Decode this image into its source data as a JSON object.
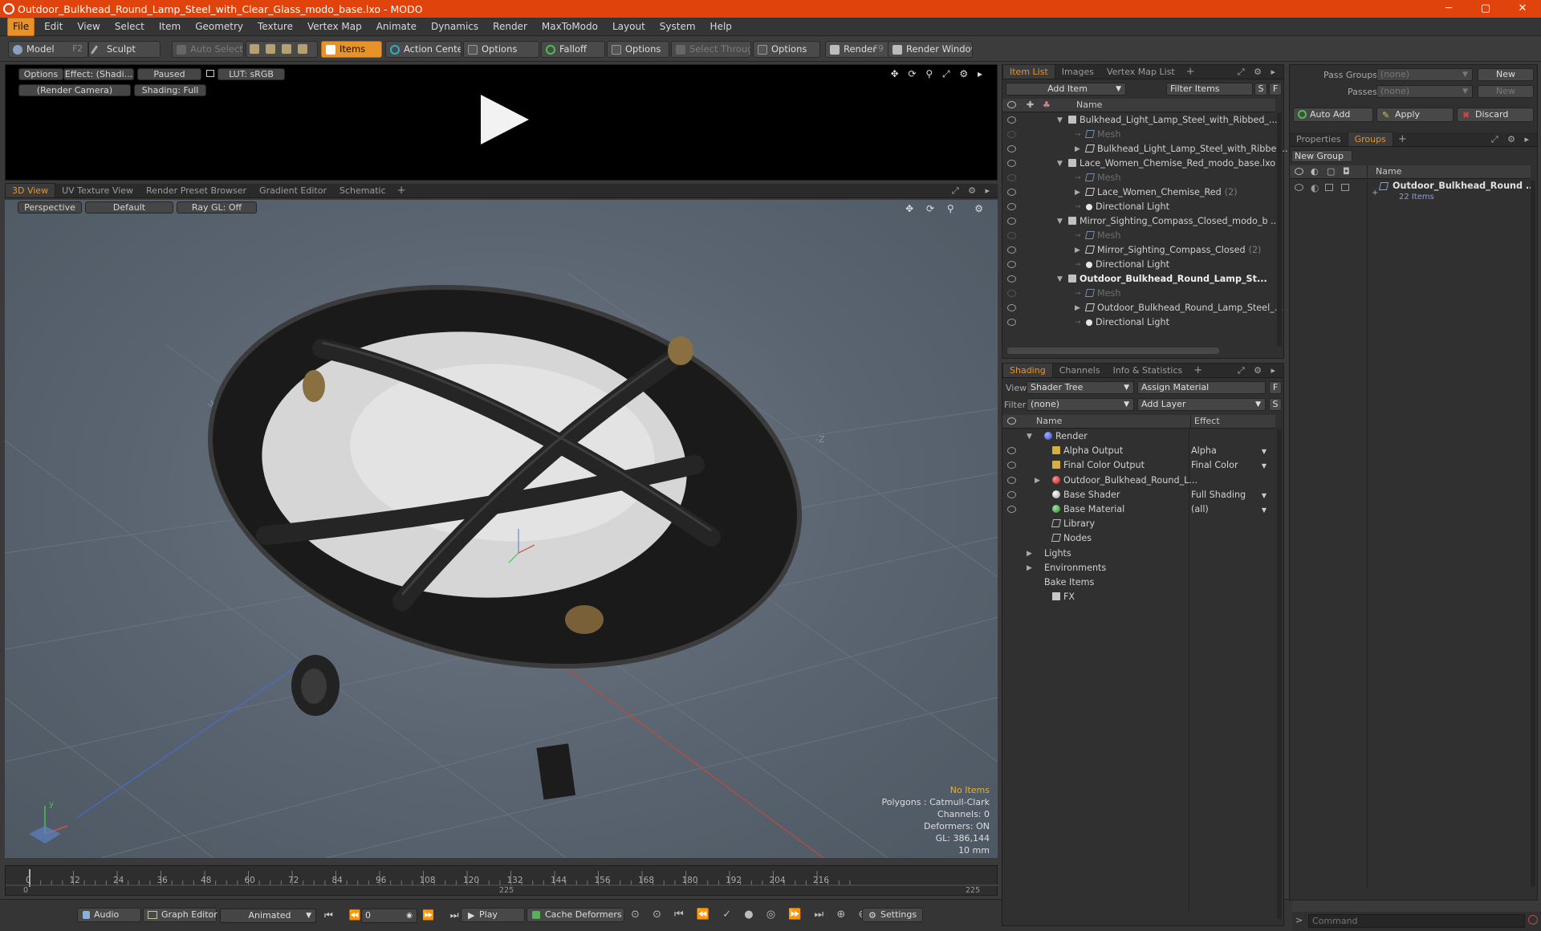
{
  "window": {
    "title": "Outdoor_Bulkhead_Round_Lamp_Steel_with_Clear_Glass_modo_base.lxo - MODO",
    "minimize": "─",
    "maximize": "▢",
    "close": "✕"
  },
  "menu": [
    "File",
    "Edit",
    "View",
    "Select",
    "Item",
    "Geometry",
    "Texture",
    "Vertex Map",
    "Animate",
    "Dynamics",
    "Render",
    "MaxToModo",
    "Layout",
    "System",
    "Help"
  ],
  "toolbar": {
    "model": "Model",
    "model_key": "F2",
    "sculpt": "Sculpt",
    "auto_select": "Auto Select",
    "items": "Items",
    "action_center": "Action Center",
    "options1": "Options",
    "falloff": "Falloff",
    "options2": "Options",
    "select_through": "Select Through",
    "options3": "Options",
    "render": "Render",
    "render_key": "F9",
    "render_window": "Render Window"
  },
  "render_preview": {
    "options": "Options",
    "effect": "Effect: (Shadi...",
    "paused": "Paused",
    "lut": "LUT: sRGB",
    "camera": "(Render Camera)",
    "shading": "Shading: Full"
  },
  "viewport_tabs": [
    "3D View",
    "UV Texture View",
    "Render Preset Browser",
    "Gradient Editor",
    "Schematic"
  ],
  "viewport": {
    "perspective": "Perspective",
    "default": "Default",
    "raygl": "Ray GL: Off",
    "info": {
      "no_items": "No Items",
      "polygons": "Polygons : Catmull-Clark",
      "channels": "Channels: 0",
      "deformers": "Deformers: ON",
      "gl": "GL: 386,144",
      "scale": "10 mm"
    }
  },
  "item_list": {
    "tabs": [
      "Item List",
      "Images",
      "Vertex Map List"
    ],
    "add_item": "Add Item",
    "filter_items": "Filter Items",
    "s": "S",
    "f": "F",
    "name_header": "Name",
    "rows": [
      {
        "label": "Bulkhead_Light_Lamp_Steel_with_Ribbed_...",
        "type": "scene",
        "indent": 0,
        "expanded": true,
        "bold": false,
        "dim": false
      },
      {
        "label": "Mesh",
        "type": "mesh",
        "indent": 1,
        "dim": true
      },
      {
        "label": "Bulkhead_Light_Lamp_Steel_with_Ribbe ...",
        "type": "grp",
        "indent": 1,
        "collapsed": true
      },
      {
        "label": "Lace_Women_Chemise_Red_modo_base.lxo",
        "type": "scene",
        "indent": 0,
        "expanded": true
      },
      {
        "label": "Mesh",
        "type": "mesh",
        "indent": 1,
        "dim": true
      },
      {
        "label": "Lace_Women_Chemise_Red",
        "count": "(2)",
        "type": "grp",
        "indent": 1,
        "collapsed": true
      },
      {
        "label": "Directional Light",
        "type": "light",
        "indent": 1
      },
      {
        "label": "Mirror_Sighting_Compass_Closed_modo_b ...",
        "type": "scene",
        "indent": 0,
        "expanded": true
      },
      {
        "label": "Mesh",
        "type": "mesh",
        "indent": 1,
        "dim": true
      },
      {
        "label": "Mirror_Sighting_Compass_Closed",
        "count": "(2)",
        "type": "grp",
        "indent": 1,
        "collapsed": true
      },
      {
        "label": "Directional Light",
        "type": "light",
        "indent": 1
      },
      {
        "label": "Outdoor_Bulkhead_Round_Lamp_St...",
        "type": "scene",
        "indent": 0,
        "expanded": true,
        "bold": true
      },
      {
        "label": "Mesh",
        "type": "mesh",
        "indent": 1,
        "dim": true
      },
      {
        "label": "Outdoor_Bulkhead_Round_Lamp_Steel_...",
        "type": "grp",
        "indent": 1,
        "collapsed": true
      },
      {
        "label": "Directional Light",
        "type": "light",
        "indent": 1
      }
    ]
  },
  "shading": {
    "tabs": [
      "Shading",
      "Channels",
      "Info & Statistics"
    ],
    "view_label": "View",
    "view_value": "Shader Tree",
    "assign_material": "Assign Material",
    "filter_label": "Filter",
    "filter_value": "(none)",
    "add_layer": "Add Layer",
    "col_name": "Name",
    "col_effect": "Effect",
    "rows": [
      {
        "label": "Render",
        "icon": "sphere-b",
        "indent": 0,
        "tri": "▼",
        "eye": false,
        "effect": ""
      },
      {
        "label": "Alpha Output",
        "icon": "out",
        "indent": 1,
        "eye": true,
        "effect": "Alpha"
      },
      {
        "label": "Final Color Output",
        "icon": "out",
        "indent": 1,
        "eye": true,
        "effect": "Final Color"
      },
      {
        "label": "Outdoor_Bulkhead_Round_L...",
        "icon": "sphere-r",
        "indent": 1,
        "tri": "▶",
        "eye": true,
        "effect": ""
      },
      {
        "label": "Base Shader",
        "icon": "sphere-w",
        "indent": 1,
        "eye": true,
        "effect": "Full Shading"
      },
      {
        "label": "Base Material",
        "icon": "sphere-g",
        "indent": 1,
        "eye": true,
        "effect": "(all)"
      },
      {
        "label": "Library",
        "icon": "fld",
        "indent": 1,
        "eye": false,
        "effect": ""
      },
      {
        "label": "Nodes",
        "icon": "fld",
        "indent": 1,
        "eye": false,
        "effect": ""
      },
      {
        "label": "Lights",
        "icon": "",
        "indent": 0,
        "tri": "▶",
        "eye": false,
        "effect": ""
      },
      {
        "label": "Environments",
        "icon": "",
        "indent": 0,
        "tri": "▶",
        "eye": false,
        "effect": ""
      },
      {
        "label": "Bake Items",
        "icon": "",
        "indent": 0,
        "eye": false,
        "effect": ""
      },
      {
        "label": "FX",
        "icon": "fx",
        "indent": 1,
        "eye": false,
        "effect": ""
      }
    ]
  },
  "right_panel": {
    "pass_groups": "Pass Groups",
    "pass_groups_value": "(none)",
    "new1": "New",
    "passes": "Passes",
    "passes_value": "(none)",
    "new2": "New",
    "auto_add": "Auto Add",
    "apply": "Apply",
    "discard": "Discard",
    "tabs": [
      "Properties",
      "Groups"
    ],
    "new_group": "New Group",
    "name_header": "Name",
    "group_name": "Outdoor_Bulkhead_Round ...",
    "group_count": "22 Items"
  },
  "timeline": {
    "ticks": [
      "0",
      "12",
      "24",
      "36",
      "48",
      "60",
      "72",
      "84",
      "96",
      "108",
      "120",
      "132",
      "144",
      "156",
      "168",
      "180",
      "192",
      "204",
      "216"
    ],
    "start": "0",
    "mid": "225",
    "end": "225"
  },
  "bottom": {
    "audio": "Audio",
    "graph_editor": "Graph Editor",
    "animated": "Animated",
    "frame": "0",
    "play": "Play",
    "cache_deformers": "Cache Deformers",
    "settings": "Settings",
    "command_placeholder": "Command"
  },
  "colors": {
    "accent": "#e8932a",
    "titlebar": "#e0430b"
  }
}
